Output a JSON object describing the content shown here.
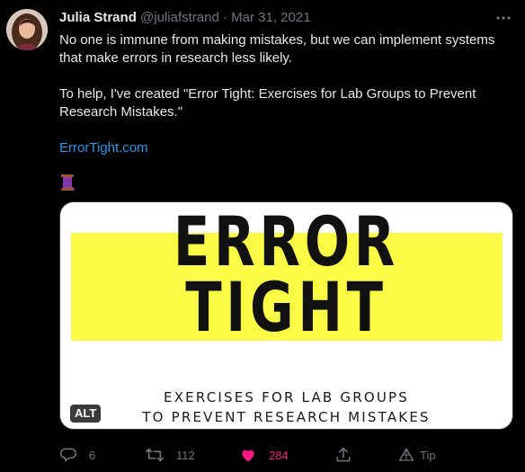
{
  "author": {
    "name": "Julia Strand",
    "handle": "@juliafstrand",
    "separator": "·",
    "date": "Mar 31, 2021"
  },
  "tweet": {
    "line1": "No one is immune from making mistakes, but we can implement systems that make errors in research less likely.",
    "line2": "To help, I've created \"Error Tight: Exercises for Lab Groups to Prevent Research Mistakes.\"",
    "link": "ErrorTight.com",
    "emoji": "thread-spool-icon"
  },
  "media": {
    "title_line1": "ERROR",
    "title_line2": "TIGHT",
    "subtitle_line1": "EXERCISES FOR LAB GROUPS",
    "subtitle_line2": "TO PREVENT RESEARCH MISTAKES",
    "alt_badge": "ALT",
    "highlight_color": "#fbfa44"
  },
  "actions": {
    "reply_count": "6",
    "retweet_count": "112",
    "like_count": "284",
    "tip_label": "Tip"
  },
  "colors": {
    "background": "#000000",
    "text": "#e7e9ea",
    "muted": "#71767b",
    "link": "#1d9bf0",
    "like": "#f91880"
  }
}
